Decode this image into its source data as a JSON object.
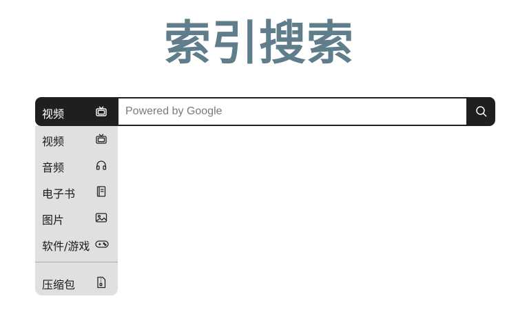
{
  "logo": {
    "title": "索引搜索"
  },
  "search": {
    "selected_category": "视频",
    "selected_icon": "tv-icon",
    "placeholder": "Powered by Google",
    "value": "",
    "submit_icon": "search-icon"
  },
  "menu": {
    "items": [
      {
        "label": "视频",
        "icon": "tv-icon"
      },
      {
        "label": "音频",
        "icon": "headphones-icon"
      },
      {
        "label": "电子书",
        "icon": "book-icon"
      },
      {
        "label": "图片",
        "icon": "image-icon"
      },
      {
        "label": "软件/游戏",
        "icon": "gamepad-icon"
      },
      {
        "label": "压缩包",
        "icon": "archive-icon"
      }
    ]
  },
  "colors": {
    "brand": "#607d8b",
    "bar": "#1f1f1f",
    "menu_bg": "#e0e0e0"
  }
}
